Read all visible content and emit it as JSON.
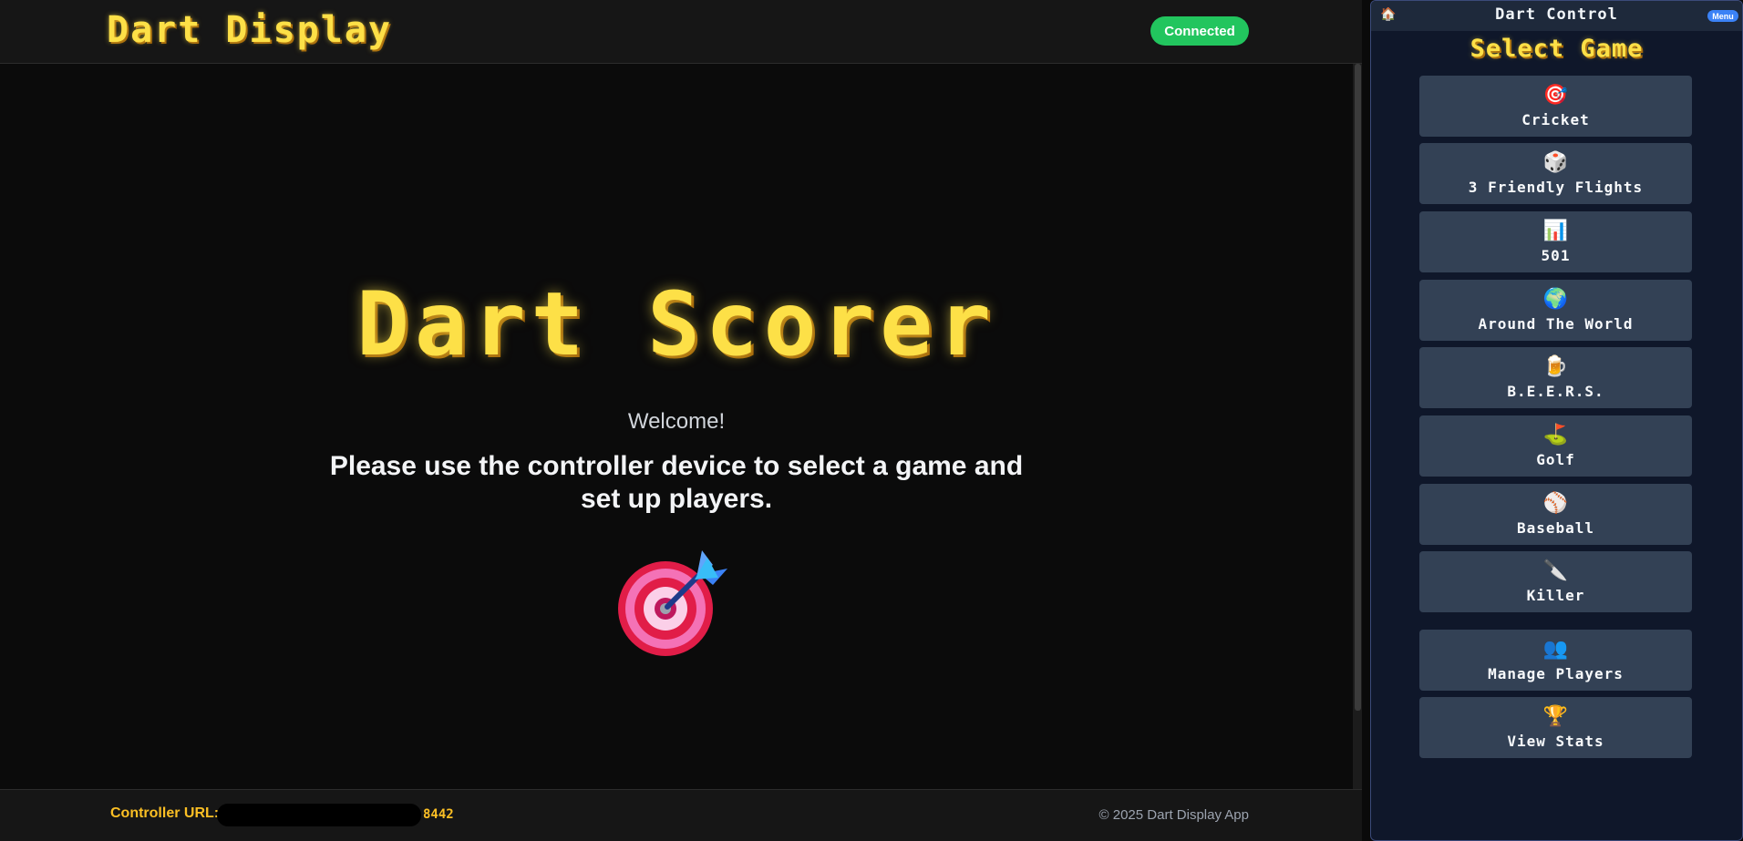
{
  "display": {
    "brand": "Dart Display",
    "status": "Connected",
    "hero_title": "Dart Scorer",
    "welcome": "Welcome!",
    "instructions": "Please use the controller device to select a game and set up players.",
    "footer": {
      "controller_label": "Controller URL:",
      "controller_port": "8442",
      "copyright": "© 2025 Dart Display App"
    }
  },
  "controller": {
    "home_icon": "🏠",
    "title": "Dart Control",
    "menu_label": "Menu",
    "heading": "Select Game",
    "games": [
      {
        "icon": "🎯",
        "label": "Cricket"
      },
      {
        "icon": "🎲",
        "label": "3 Friendly Flights"
      },
      {
        "icon": "📊",
        "label": "501"
      },
      {
        "icon": "🌍",
        "label": "Around The World"
      },
      {
        "icon": "🍺",
        "label": "B.E.E.R.S."
      },
      {
        "icon": "⛳",
        "label": "Golf"
      },
      {
        "icon": "⚾",
        "label": "Baseball"
      },
      {
        "icon": "🔪",
        "label": "Killer"
      }
    ],
    "actions": [
      {
        "icon": "👥",
        "label": "Manage Players"
      },
      {
        "icon": "🏆",
        "label": "View Stats"
      }
    ]
  },
  "colors": {
    "accent_yellow": "#fde047",
    "connected_green": "#22c55e",
    "panel_bg": "#0f172a",
    "button_bg": "#334155"
  }
}
